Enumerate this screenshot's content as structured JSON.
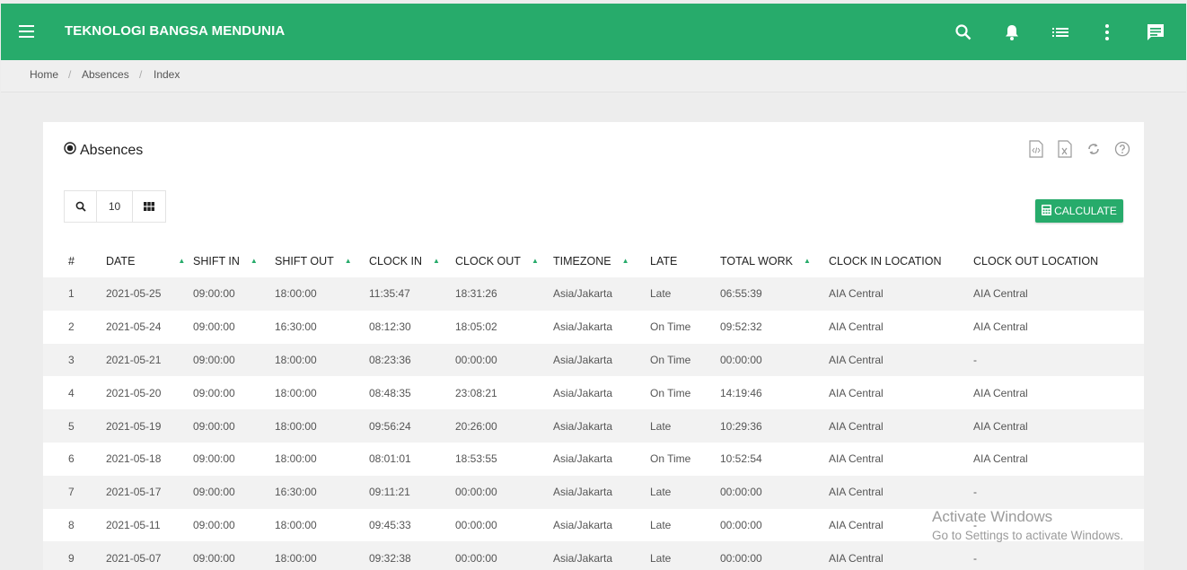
{
  "app": {
    "title": "TEKNOLOGI BANGSA MENDUNIA"
  },
  "topbar_icons": [
    "menu-icon",
    "search-icon",
    "bell-icon",
    "list-icon",
    "more-vert-icon",
    "chat-icon"
  ],
  "breadcrumb": {
    "items": [
      "Home",
      "Absences",
      "Index"
    ],
    "separator": "/"
  },
  "card": {
    "title": "Absences",
    "page_size": "10",
    "calculate_label": "CALCULATE"
  },
  "colors": {
    "accent": "#27ab6b",
    "zebra": "#f2f2f2"
  },
  "table": {
    "headers": [
      {
        "label": "#",
        "sortable": false
      },
      {
        "label": "DATE",
        "sortable": true
      },
      {
        "label": "SHIFT IN",
        "sortable": true
      },
      {
        "label": "SHIFT OUT",
        "sortable": true
      },
      {
        "label": "CLOCK IN",
        "sortable": true
      },
      {
        "label": "CLOCK OUT",
        "sortable": true
      },
      {
        "label": "TIMEZONE",
        "sortable": true
      },
      {
        "label": "LATE",
        "sortable": false
      },
      {
        "label": "TOTAL WORK",
        "sortable": true
      },
      {
        "label": "CLOCK IN LOCATION",
        "sortable": false
      },
      {
        "label": "CLOCK OUT LOCATION",
        "sortable": false
      }
    ],
    "rows": [
      [
        "1",
        "2021-05-25",
        "09:00:00",
        "18:00:00",
        "11:35:47",
        "18:31:26",
        "Asia/Jakarta",
        "Late",
        "06:55:39",
        "AIA Central",
        "AIA Central"
      ],
      [
        "2",
        "2021-05-24",
        "09:00:00",
        "16:30:00",
        "08:12:30",
        "18:05:02",
        "Asia/Jakarta",
        "On Time",
        "09:52:32",
        "AIA Central",
        "AIA Central"
      ],
      [
        "3",
        "2021-05-21",
        "09:00:00",
        "18:00:00",
        "08:23:36",
        "00:00:00",
        "Asia/Jakarta",
        "On Time",
        "00:00:00",
        "AIA Central",
        "-"
      ],
      [
        "4",
        "2021-05-20",
        "09:00:00",
        "18:00:00",
        "08:48:35",
        "23:08:21",
        "Asia/Jakarta",
        "On Time",
        "14:19:46",
        "AIA Central",
        "AIA Central"
      ],
      [
        "5",
        "2021-05-19",
        "09:00:00",
        "18:00:00",
        "09:56:24",
        "20:26:00",
        "Asia/Jakarta",
        "Late",
        "10:29:36",
        "AIA Central",
        "AIA Central"
      ],
      [
        "6",
        "2021-05-18",
        "09:00:00",
        "18:00:00",
        "08:01:01",
        "18:53:55",
        "Asia/Jakarta",
        "On Time",
        "10:52:54",
        "AIA Central",
        "AIA Central"
      ],
      [
        "7",
        "2021-05-17",
        "09:00:00",
        "16:30:00",
        "09:11:21",
        "00:00:00",
        "Asia/Jakarta",
        "Late",
        "00:00:00",
        "AIA Central",
        "-"
      ],
      [
        "8",
        "2021-05-11",
        "09:00:00",
        "18:00:00",
        "09:45:33",
        "00:00:00",
        "Asia/Jakarta",
        "Late",
        "00:00:00",
        "AIA Central",
        "-"
      ],
      [
        "9",
        "2021-05-07",
        "09:00:00",
        "18:00:00",
        "09:32:38",
        "00:00:00",
        "Asia/Jakarta",
        "Late",
        "00:00:00",
        "AIA Central",
        "-"
      ]
    ]
  },
  "watermark": {
    "line1": "Activate Windows",
    "line2": "Go to Settings to activate Windows."
  }
}
